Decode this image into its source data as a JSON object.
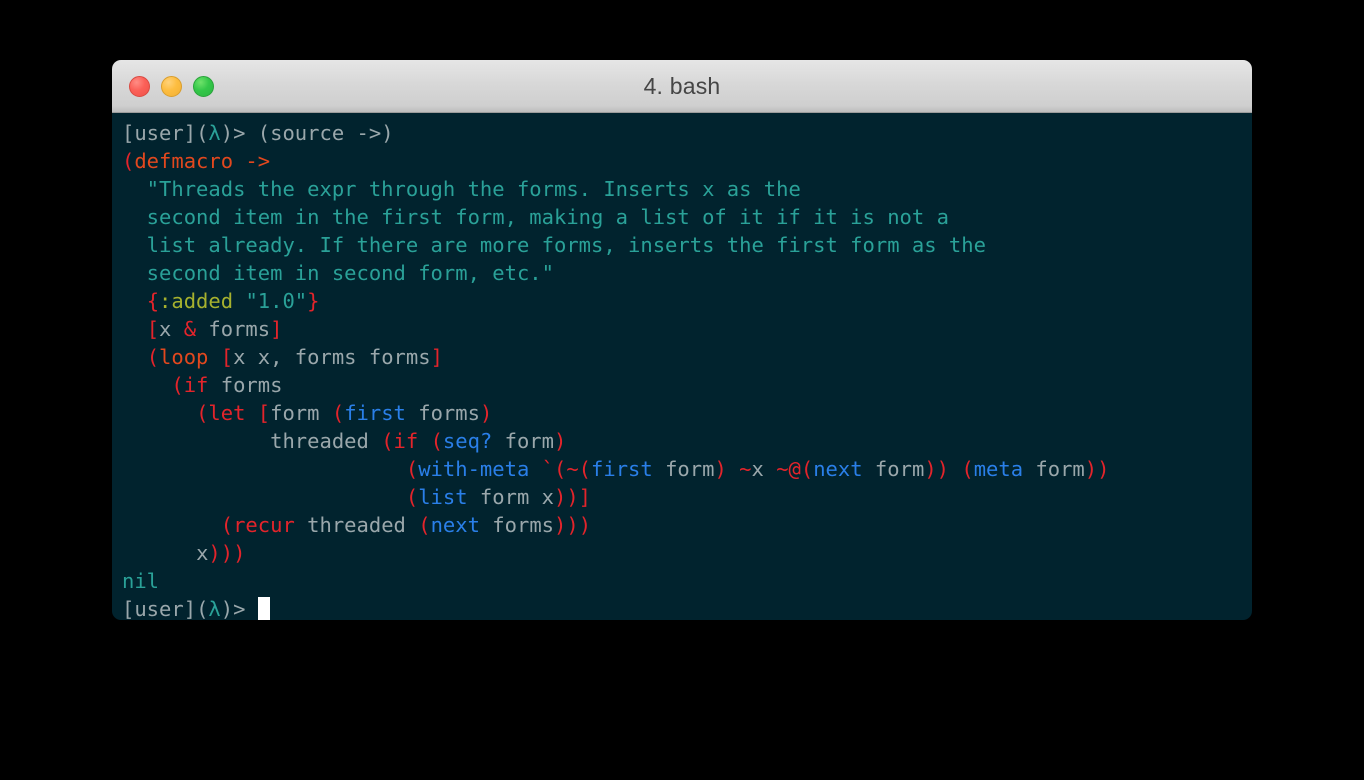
{
  "window": {
    "title": "4. bash",
    "controls": [
      {
        "name": "close",
        "color": "#fb6058"
      },
      {
        "name": "minimize",
        "color": "#fdbd40"
      },
      {
        "name": "maximize",
        "color": "#34c749"
      }
    ]
  },
  "theme": {
    "background": "#01232e",
    "titlebar_top": "#e6e6e6",
    "titlebar_bottom": "#bdbdbd",
    "foreground": "#9aa7ab",
    "red": "#e3242b",
    "orange": "#e2481e",
    "blue": "#2a7fe8",
    "cyan": "#2aa198",
    "yellow": "#a6b12e",
    "cursor": "#ffffff"
  },
  "terminal": {
    "prompt_user": "[user]",
    "prompt_lambda": "(λ)>",
    "command": "(source ->)",
    "result": "nil",
    "lines": [
      {
        "id": "line-1",
        "text": "[user](λ)> (source ->)"
      },
      {
        "id": "line-2",
        "text": "(defmacro ->"
      },
      {
        "id": "line-3",
        "text": "  \"Threads the expr through the forms. Inserts x as the"
      },
      {
        "id": "line-4",
        "text": "  second item in the first form, making a list of it if it is not a"
      },
      {
        "id": "line-5",
        "text": "  list already. If there are more forms, inserts the first form as the"
      },
      {
        "id": "line-6",
        "text": "  second item in second form, etc.\""
      },
      {
        "id": "line-7",
        "text": "  {:added \"1.0\"}"
      },
      {
        "id": "line-8",
        "text": "  [x & forms]"
      },
      {
        "id": "line-9",
        "text": "  (loop [x x, forms forms]"
      },
      {
        "id": "line-10",
        "text": "    (if forms"
      },
      {
        "id": "line-11",
        "text": "      (let [form (first forms)"
      },
      {
        "id": "line-12",
        "text": "            threaded (if (seq? form)"
      },
      {
        "id": "line-13",
        "text": "                       (with-meta `(~(first form) ~x ~@(next form)) (meta form))"
      },
      {
        "id": "line-14",
        "text": "                       (list form x))]"
      },
      {
        "id": "line-15",
        "text": "        (recur threaded (next forms)))"
      },
      {
        "id": "line-16",
        "text": "      x)))"
      },
      {
        "id": "line-17",
        "text": "nil"
      },
      {
        "id": "line-18",
        "text": "[user](λ)> "
      }
    ],
    "tokens": [
      [
        {
          "t": "[user]",
          "c": "c-gray"
        },
        {
          "t": "(",
          "c": "c-gray"
        },
        {
          "t": "λ",
          "c": "c-lambda"
        },
        {
          "t": ")> ",
          "c": "c-gray"
        },
        {
          "t": "(source ->)",
          "c": "c-gray"
        }
      ],
      [
        {
          "t": "(",
          "c": "c-red"
        },
        {
          "t": "defmacro",
          "c": "c-orange"
        },
        {
          "t": " ->",
          "c": "c-orange"
        }
      ],
      [
        {
          "t": "  \"Threads the expr through the forms. Inserts x as the",
          "c": "c-string"
        }
      ],
      [
        {
          "t": "  second item in the first form, making a list of it if it is not a",
          "c": "c-string"
        }
      ],
      [
        {
          "t": "  list already. If there are more forms, inserts the first form as the",
          "c": "c-string"
        }
      ],
      [
        {
          "t": "  second item in second form, etc.\"",
          "c": "c-string"
        }
      ],
      [
        {
          "t": "  ",
          "c": "c-default"
        },
        {
          "t": "{",
          "c": "c-red"
        },
        {
          "t": ":added",
          "c": "c-yellow"
        },
        {
          "t": " ",
          "c": "c-default"
        },
        {
          "t": "\"1.0\"",
          "c": "c-string"
        },
        {
          "t": "}",
          "c": "c-red"
        }
      ],
      [
        {
          "t": "  ",
          "c": "c-default"
        },
        {
          "t": "[",
          "c": "c-red"
        },
        {
          "t": "x ",
          "c": "c-gray"
        },
        {
          "t": "&",
          "c": "c-red"
        },
        {
          "t": " forms",
          "c": "c-gray"
        },
        {
          "t": "]",
          "c": "c-red"
        }
      ],
      [
        {
          "t": "  ",
          "c": "c-default"
        },
        {
          "t": "(",
          "c": "c-red"
        },
        {
          "t": "loop",
          "c": "c-orange"
        },
        {
          "t": " ",
          "c": "c-gray"
        },
        {
          "t": "[",
          "c": "c-red"
        },
        {
          "t": "x x, forms forms",
          "c": "c-gray"
        },
        {
          "t": "]",
          "c": "c-red"
        }
      ],
      [
        {
          "t": "    ",
          "c": "c-default"
        },
        {
          "t": "(",
          "c": "c-red"
        },
        {
          "t": "if",
          "c": "c-red"
        },
        {
          "t": " forms",
          "c": "c-gray"
        }
      ],
      [
        {
          "t": "      ",
          "c": "c-default"
        },
        {
          "t": "(",
          "c": "c-red"
        },
        {
          "t": "let",
          "c": "c-red"
        },
        {
          "t": " ",
          "c": "c-gray"
        },
        {
          "t": "[",
          "c": "c-red"
        },
        {
          "t": "form ",
          "c": "c-gray"
        },
        {
          "t": "(",
          "c": "c-red"
        },
        {
          "t": "first",
          "c": "c-blue"
        },
        {
          "t": " forms",
          "c": "c-gray"
        },
        {
          "t": ")",
          "c": "c-red"
        }
      ],
      [
        {
          "t": "            threaded ",
          "c": "c-gray"
        },
        {
          "t": "(",
          "c": "c-red"
        },
        {
          "t": "if",
          "c": "c-red"
        },
        {
          "t": " ",
          "c": "c-gray"
        },
        {
          "t": "(",
          "c": "c-red"
        },
        {
          "t": "seq?",
          "c": "c-blue"
        },
        {
          "t": " form",
          "c": "c-gray"
        },
        {
          "t": ")",
          "c": "c-red"
        }
      ],
      [
        {
          "t": "                       ",
          "c": "c-default"
        },
        {
          "t": "(",
          "c": "c-red"
        },
        {
          "t": "with-meta",
          "c": "c-blue"
        },
        {
          "t": " ",
          "c": "c-gray"
        },
        {
          "t": "`(~(",
          "c": "c-red"
        },
        {
          "t": "first",
          "c": "c-blue"
        },
        {
          "t": " form",
          "c": "c-gray"
        },
        {
          "t": ")",
          "c": "c-red"
        },
        {
          "t": " ",
          "c": "c-gray"
        },
        {
          "t": "~",
          "c": "c-red"
        },
        {
          "t": "x ",
          "c": "c-gray"
        },
        {
          "t": "~@(",
          "c": "c-red"
        },
        {
          "t": "next",
          "c": "c-blue"
        },
        {
          "t": " form",
          "c": "c-gray"
        },
        {
          "t": "))",
          "c": "c-red"
        },
        {
          "t": " ",
          "c": "c-gray"
        },
        {
          "t": "(",
          "c": "c-red"
        },
        {
          "t": "meta",
          "c": "c-blue"
        },
        {
          "t": " form",
          "c": "c-gray"
        },
        {
          "t": "))",
          "c": "c-red"
        }
      ],
      [
        {
          "t": "                       ",
          "c": "c-default"
        },
        {
          "t": "(",
          "c": "c-red"
        },
        {
          "t": "list",
          "c": "c-blue"
        },
        {
          "t": " form x",
          "c": "c-gray"
        },
        {
          "t": "))]",
          "c": "c-red"
        }
      ],
      [
        {
          "t": "        ",
          "c": "c-default"
        },
        {
          "t": "(",
          "c": "c-red"
        },
        {
          "t": "recur",
          "c": "c-red"
        },
        {
          "t": " threaded ",
          "c": "c-gray"
        },
        {
          "t": "(",
          "c": "c-red"
        },
        {
          "t": "next",
          "c": "c-blue"
        },
        {
          "t": " forms",
          "c": "c-gray"
        },
        {
          "t": ")))",
          "c": "c-red"
        }
      ],
      [
        {
          "t": "      ",
          "c": "c-default"
        },
        {
          "t": "x",
          "c": "c-gray"
        },
        {
          "t": ")))",
          "c": "c-red"
        }
      ],
      [
        {
          "t": "nil",
          "c": "c-cyan"
        }
      ],
      [
        {
          "t": "[user]",
          "c": "c-gray"
        },
        {
          "t": "(",
          "c": "c-gray"
        },
        {
          "t": "λ",
          "c": "c-lambda"
        },
        {
          "t": ")> ",
          "c": "c-gray"
        }
      ]
    ],
    "cursor_line_index": 17
  }
}
